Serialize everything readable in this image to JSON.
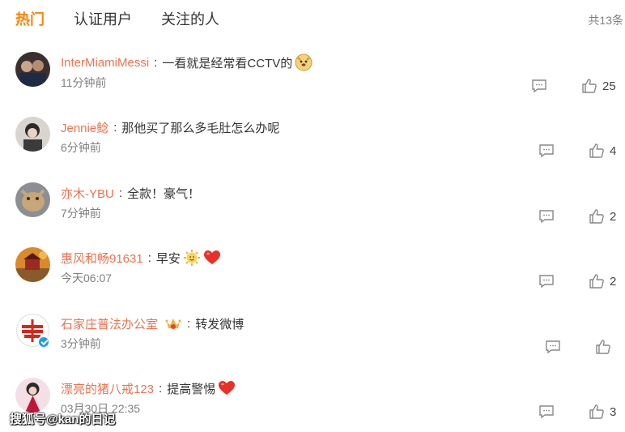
{
  "tabs": [
    {
      "label": "热门"
    },
    {
      "label": "认证用户"
    },
    {
      "label": "关注的人"
    }
  ],
  "total": "共13条",
  "comments": [
    {
      "user": "InterMiamiMessi",
      "text": "一看就是经常看CCTV的",
      "time": "11分钟前",
      "likes": "25",
      "emojis": [
        "doge-emoji"
      ]
    },
    {
      "user": "Jennie鲶",
      "text": "那他买了那么多毛肚怎么办呢",
      "time": "6分钟前",
      "likes": "4",
      "emojis": []
    },
    {
      "user": "亦木-YBU",
      "text": "全款！豪气！",
      "time": "7分钟前",
      "likes": "2",
      "emojis": []
    },
    {
      "user": "惠风和畅91631",
      "text": "早安",
      "time": "今天06:07",
      "likes": "2",
      "emojis": [
        "sun-emoji",
        "heart-emoji"
      ]
    },
    {
      "user": "石家庄普法办公室",
      "text": "转发微博",
      "time": "3分钟前",
      "likes": "",
      "emojis": []
    },
    {
      "user": "漂亮的猪八戒123",
      "text": "提高警惕",
      "time": "03月30日 22:35",
      "likes": "3",
      "emojis": [
        "heart-emoji"
      ]
    }
  ],
  "colors": {
    "accent": "#ff8200",
    "username": "#eb7350",
    "muted": "#808080",
    "verified": "#1d9bf0"
  },
  "watermark": "搜狐号@kan的日记"
}
